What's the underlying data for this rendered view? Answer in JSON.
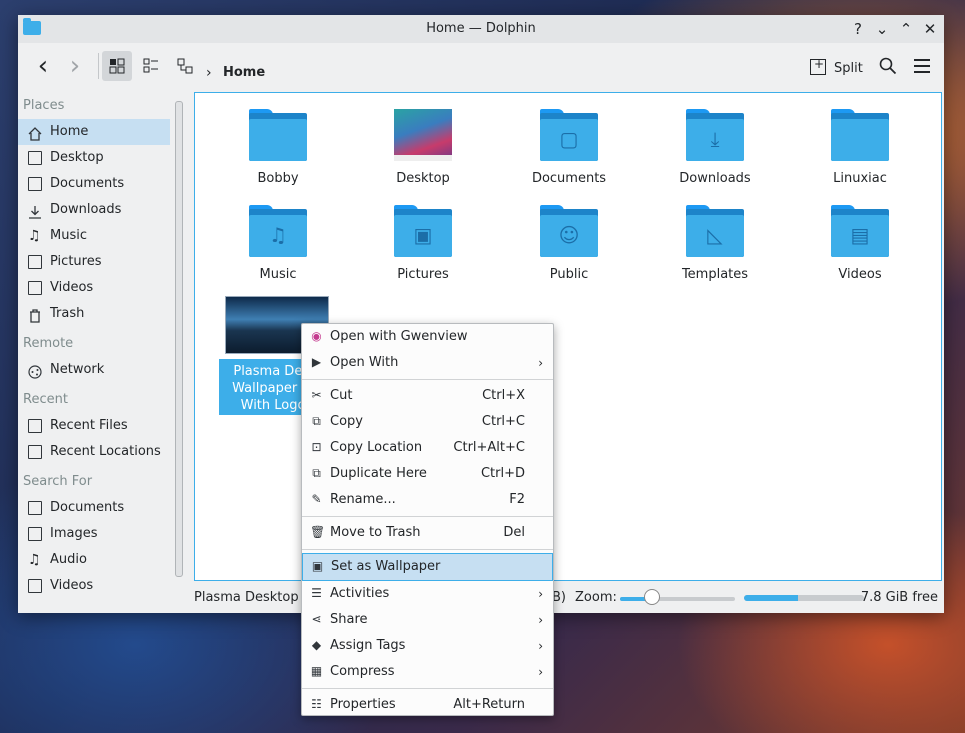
{
  "window": {
    "title": "Home — Dolphin",
    "controls": [
      "?",
      "⌄",
      "⌃",
      "✕"
    ]
  },
  "toolbar": {
    "back_glyph": "‹",
    "forward_glyph": "›",
    "breadcrumb": "Home",
    "split_label": "Split"
  },
  "sidebar": {
    "places_title": "Places",
    "places": [
      "Home",
      "Desktop",
      "Documents",
      "Downloads",
      "Music",
      "Pictures",
      "Videos",
      "Trash"
    ],
    "remote_title": "Remote",
    "remote": [
      "Network"
    ],
    "recent_title": "Recent",
    "recent": [
      "Recent Files",
      "Recent Locations"
    ],
    "search_title": "Search For",
    "search": [
      "Documents",
      "Images",
      "Audio",
      "Videos"
    ]
  },
  "files": [
    {
      "name": "Bobby",
      "symbol": ""
    },
    {
      "name": "Desktop",
      "symbol": ""
    },
    {
      "name": "Documents",
      "symbol": "▢"
    },
    {
      "name": "Downloads",
      "symbol": "⤓"
    },
    {
      "name": "Linuxiac",
      "symbol": ""
    },
    {
      "name": "Music",
      "symbol": "♫"
    },
    {
      "name": "Pictures",
      "symbol": "▣"
    },
    {
      "name": "Public",
      "symbol": "☺"
    },
    {
      "name": "Templates",
      "symbol": "◺"
    },
    {
      "name": "Videos",
      "symbol": "▤"
    }
  ],
  "selected_file": {
    "line1": "Plasma Desk",
    "line2": "Wallpaper 30",
    "line3": "With Logo."
  },
  "status": {
    "left_text": "Plasma Desktop W",
    "middle_text": "B)",
    "zoom_label": "Zoom:",
    "zoom_fraction": 0.28,
    "used_fraction": 0.45,
    "free_space": "7.8 GiB free"
  },
  "context_menu": {
    "items": [
      {
        "label": "Open with Gwenview",
        "shortcut": "",
        "submenu": false,
        "icon": "◉"
      },
      {
        "label": "Open With",
        "shortcut": "",
        "submenu": true,
        "icon": "▶"
      },
      {
        "label": "Cut",
        "shortcut": "Ctrl+X",
        "submenu": false,
        "icon": "✂"
      },
      {
        "label": "Copy",
        "shortcut": "Ctrl+C",
        "submenu": false,
        "icon": "⧉"
      },
      {
        "label": "Copy Location",
        "shortcut": "Ctrl+Alt+C",
        "submenu": false,
        "icon": "⊡"
      },
      {
        "label": "Duplicate Here",
        "shortcut": "Ctrl+D",
        "submenu": false,
        "icon": "⧉"
      },
      {
        "label": "Rename...",
        "shortcut": "F2",
        "submenu": false,
        "icon": "✎"
      },
      {
        "label": "Move to Trash",
        "shortcut": "Del",
        "submenu": false,
        "icon": "🗑"
      },
      {
        "label": "Set as Wallpaper",
        "shortcut": "",
        "submenu": false,
        "icon": "▣"
      },
      {
        "label": "Activities",
        "shortcut": "",
        "submenu": true,
        "icon": "☰"
      },
      {
        "label": "Share",
        "shortcut": "",
        "submenu": true,
        "icon": "⋖"
      },
      {
        "label": "Assign Tags",
        "shortcut": "",
        "submenu": true,
        "icon": "◆"
      },
      {
        "label": "Compress",
        "shortcut": "",
        "submenu": true,
        "icon": "▦"
      },
      {
        "label": "Properties",
        "shortcut": "Alt+Return",
        "submenu": false,
        "icon": "☷"
      }
    ],
    "submenu_glyph": "›"
  }
}
